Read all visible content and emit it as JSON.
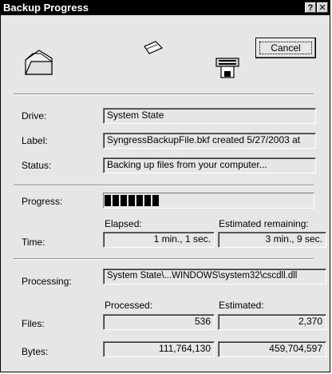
{
  "window": {
    "title": "Backup Progress",
    "help_label": "?",
    "close_label": "✕"
  },
  "buttons": {
    "cancel_label": "Cancel"
  },
  "icons": {
    "folder": "folder-icon",
    "flying_paper": "flying-document-icon",
    "backup_device": "backup-drive-icon"
  },
  "info": {
    "drive_label": "Drive:",
    "drive_value": "System State",
    "label_label": "Label:",
    "label_value": "SyngressBackupFile.bkf created 5/27/2003 at",
    "status_label": "Status:",
    "status_value": "Backing up files from your computer..."
  },
  "progress": {
    "label": "Progress:",
    "fraction": 0.26
  },
  "time": {
    "label": "Time:",
    "elapsed_header": "Elapsed:",
    "remaining_header": "Estimated remaining:",
    "elapsed_value": "1 min., 1 sec.",
    "remaining_value": "3 min., 9 sec."
  },
  "processing": {
    "label": "Processing:",
    "value": "System State\\...WINDOWS\\system32\\cscdll.dll"
  },
  "counts": {
    "processed_header": "Processed:",
    "estimated_header": "Estimated:",
    "files_label": "Files:",
    "files_processed": "536",
    "files_estimated": "2,370",
    "bytes_label": "Bytes:",
    "bytes_processed": "111,764,130",
    "bytes_estimated": "459,704,597"
  }
}
